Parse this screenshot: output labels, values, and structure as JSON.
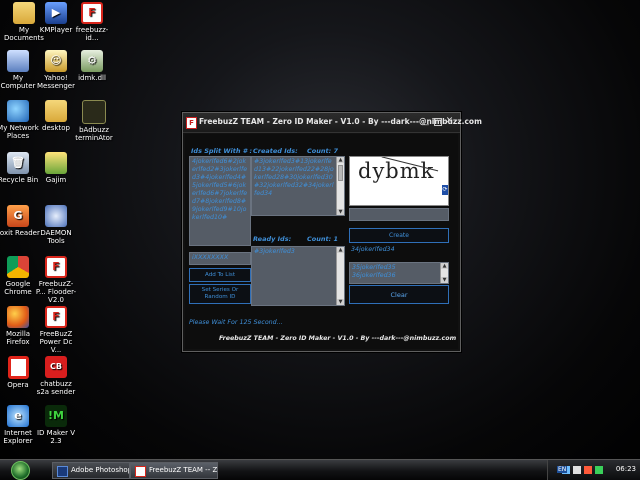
{
  "desktop": {
    "icons": [
      {
        "label": "My Documents"
      },
      {
        "label": "KMPlayer"
      },
      {
        "label": "freebuzz-id..."
      },
      {
        "label": "My Computer"
      },
      {
        "label": "Yahoo! Messenger"
      },
      {
        "label": "idmk.dll"
      },
      {
        "label": "My Network Places"
      },
      {
        "label": "desktop"
      },
      {
        "label": "bAdbuzz terminAtor"
      },
      {
        "label": "Recycle Bin"
      },
      {
        "label": "Gajim"
      },
      {
        "label": "Foxit Reader"
      },
      {
        "label": "DAEMON Tools"
      },
      {
        "label": "Google Chrome"
      },
      {
        "label": "FreebuzZ-P... Flooder-V2.0"
      },
      {
        "label": "Mozilla Firefox"
      },
      {
        "label": "FreeBuzZ Power Dc V..."
      },
      {
        "label": "Opera"
      },
      {
        "label": "chatbuzz s2a sender"
      },
      {
        "label": "Internet Explorer"
      },
      {
        "label": "ID Maker V 2.3"
      }
    ]
  },
  "window": {
    "title": "FreebuzZ TEAM - Zero ID Maker - V1.0 - By ---dark---@nimbuzz.com",
    "ids_split_label": "Ids Split With # :",
    "ids_split_text": "4jokerlfed6#2jokerlfed2#3jokerlfed3#4jokerlfed4#5jokerlfed5#6jokerlfed6#7jokerlfed7#8jokerlfed8#9jokerlfed9#10jokerlfed10#",
    "created_label": "Created Ids:",
    "created_count": "Count: 7",
    "created_text": "#3jokerlfed3#13jokerlfed13#22jokerlfed22#28jokerlfed28#30jokerlfed30#32jokerlfed32#34jokerlfed34",
    "ready_label": "Ready Ids:",
    "ready_count": "Count: 1",
    "ready_text": "#3jokerlfed3",
    "prefix_value": "iXXXXXXXX",
    "add_to_list": "Add To List",
    "set_series": "Set Series Or Random ID",
    "captcha_text": "dybmk",
    "captcha_input": "",
    "create_label": "Create",
    "current_id": "34jokerlfed34",
    "pending_list": [
      "35jokerlfed35",
      "36jokerlfed36"
    ],
    "clear_label": "Clear",
    "status": "Please Wait For 125 Second...",
    "footer": "FreebuzZ TEAM - Zero ID Maker - V1.0 - By ---dark---@nimbuzz.com"
  },
  "taskbar": {
    "items": [
      {
        "label": "Adobe Photoshop"
      },
      {
        "label": "FreebuzZ TEAM -- Ze..."
      }
    ],
    "lang": "EN",
    "clock": "06:23"
  }
}
